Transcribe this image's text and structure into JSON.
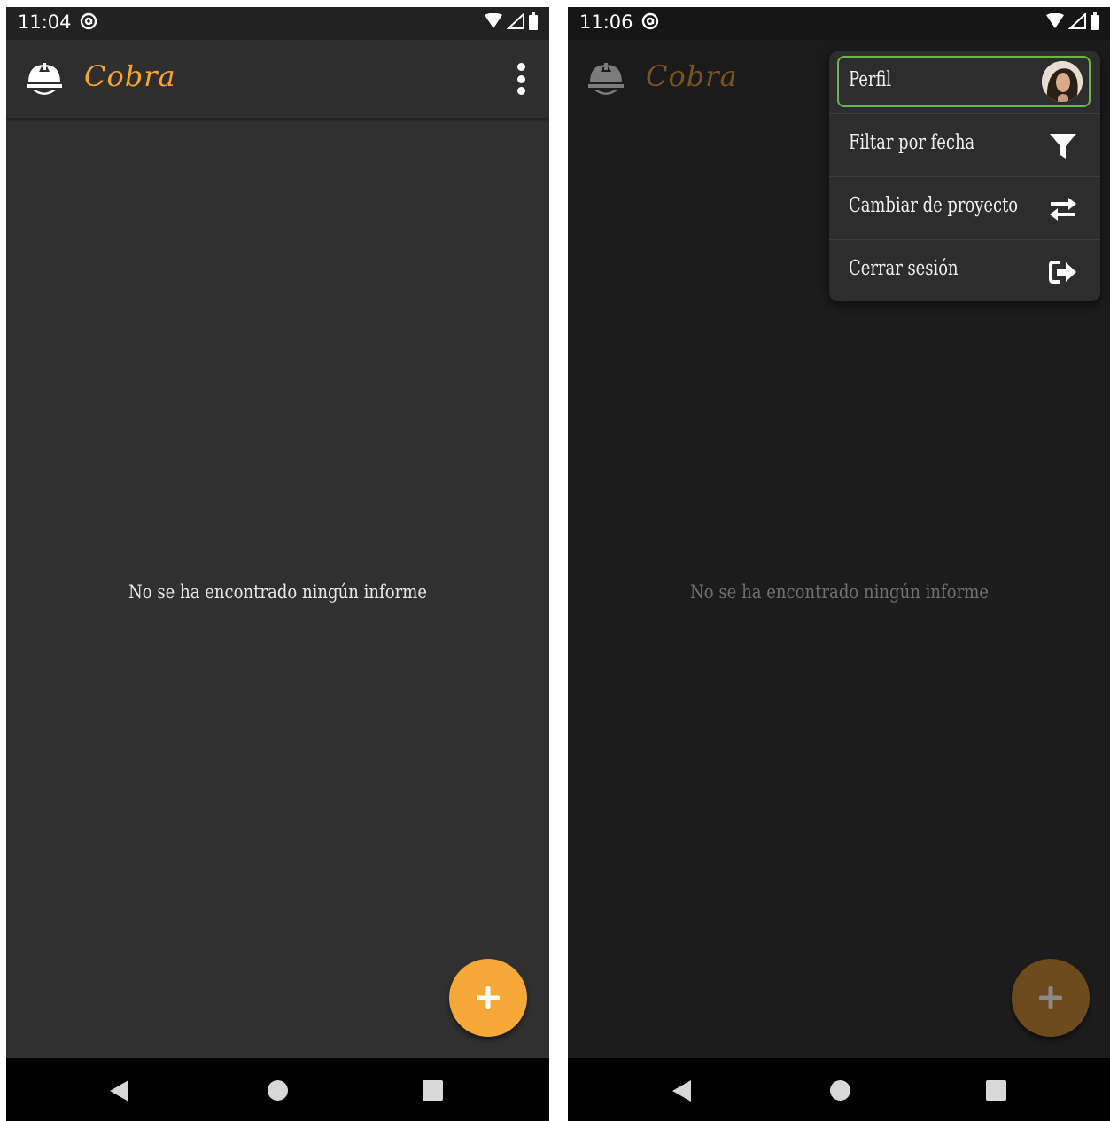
{
  "colors": {
    "accent": "#f6a838",
    "accent_dim": "#6d4a1d",
    "title_orange": "#f6a32f",
    "selected_border": "#6cb548",
    "background": "#303030",
    "scrim_background": "#1c1c1c"
  },
  "left_screen": {
    "status": {
      "time": "11:04"
    },
    "appbar": {
      "title": "Cobra",
      "logo_icon": "helmet-icon",
      "menu_icon": "more-vert-icon"
    },
    "empty_message": "No se ha encontrado ningún informe",
    "fab_icon": "plus-icon"
  },
  "right_screen": {
    "status": {
      "time": "11:06"
    },
    "appbar": {
      "title": "Cobra",
      "logo_icon": "helmet-icon"
    },
    "empty_message": "No se ha encontrado ningún informe",
    "fab_icon": "plus-icon",
    "menu": {
      "items": [
        {
          "label": "Perfil",
          "icon": "avatar"
        },
        {
          "label": "Filtar por fecha",
          "icon": "filter-icon"
        },
        {
          "label": "Cambiar de proyecto",
          "icon": "swap-icon"
        },
        {
          "label": "Cerrar sesión",
          "icon": "logout-icon"
        }
      ]
    }
  }
}
